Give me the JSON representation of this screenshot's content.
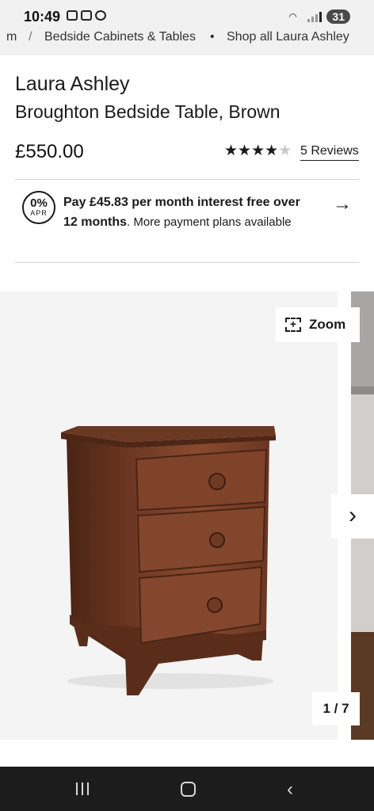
{
  "status_bar": {
    "time": "10:49",
    "battery": "31"
  },
  "breadcrumb": {
    "prev": "m",
    "sep1": "/",
    "category": "Bedside Cabinets & Tables",
    "sep2": "•",
    "shop_all": "Shop all Laura Ashley"
  },
  "product": {
    "brand": "Laura Ashley",
    "title": "Broughton Bedside Table, Brown",
    "price": "£550.00",
    "rating": 4,
    "rating_max": 5,
    "reviews_link": "5 Reviews"
  },
  "finance": {
    "badge_pct": "0%",
    "badge_apr": "APR",
    "line_bold": "Pay £45.83 per month interest free over 12 months",
    "line_rest": ". More payment plans available"
  },
  "gallery": {
    "zoom_label": "Zoom",
    "counter": "1 / 7"
  },
  "colors": {
    "wood_dark": "#5b2f1d",
    "wood_mid": "#7a4127",
    "wood_light": "#8e5034",
    "gallery_bg": "#f4f4f4"
  }
}
